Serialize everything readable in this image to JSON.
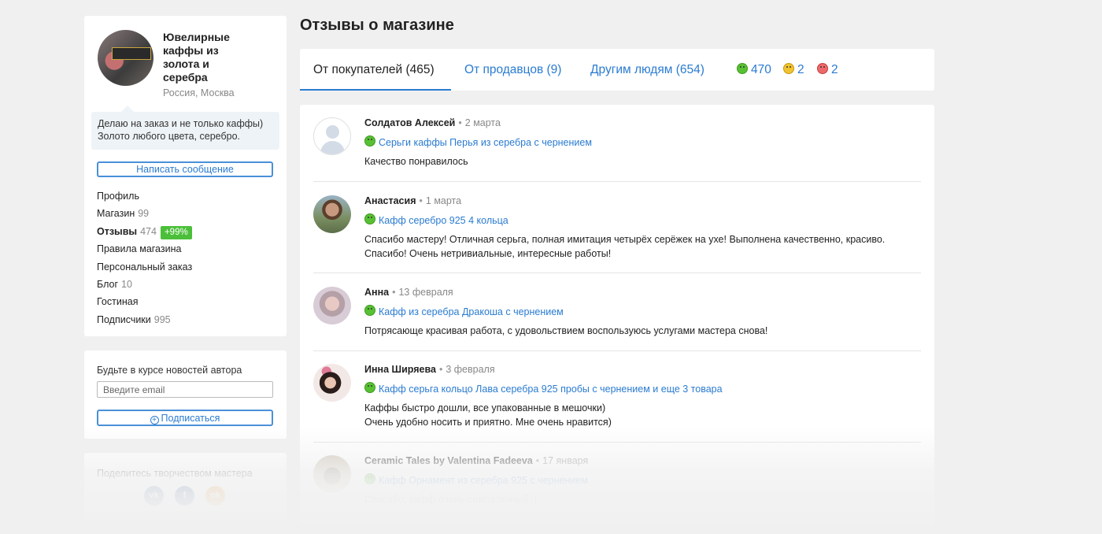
{
  "shop": {
    "name": "Ювелирные каффы из золота и серебра",
    "location": "Россия, Москва",
    "description_line1": "Делаю на заказ и не только каффы)",
    "description_line2": "Золото любого цвета, серебро.",
    "message_button": "Написать сообщение"
  },
  "sidebar_menu": [
    {
      "label": "Профиль",
      "count": ""
    },
    {
      "label": "Магазин",
      "count": "99"
    },
    {
      "label": "Отзывы",
      "count": "474",
      "badge": "+99%",
      "active": true
    },
    {
      "label": "Правила магазина",
      "count": ""
    },
    {
      "label": "Персональный заказ",
      "count": ""
    },
    {
      "label": "Блог",
      "count": "10"
    },
    {
      "label": "Гостиная",
      "count": ""
    },
    {
      "label": "Подписчики",
      "count": "995"
    }
  ],
  "subscribe": {
    "title": "Будьте в курсе новостей автора",
    "placeholder": "Введите email",
    "button": "Подписаться"
  },
  "share": {
    "title": "Поделитесь творчеством мастера",
    "icons": [
      "vk-icon",
      "facebook-icon",
      "odnoklassniki-icon"
    ]
  },
  "page": {
    "title": "Отзывы о магазине"
  },
  "tabs": [
    {
      "label": "От покупателей (465)",
      "active": true
    },
    {
      "label": "От продавцов (9)",
      "active": false
    },
    {
      "label": "Другим людям (654)",
      "active": false
    }
  ],
  "ratings": {
    "positive": "470",
    "neutral": "2",
    "negative": "2"
  },
  "reviews": [
    {
      "author": "Солдатов Алексей",
      "date": "2 марта",
      "product": "Серьги каффы Перья из серебра с чернением",
      "text_lines": [
        "Качество понравилось"
      ]
    },
    {
      "author": "Анастасия",
      "date": "1 марта",
      "product": "Кафф серебро 925 4 кольца",
      "text_lines": [
        "Спасибо мастеру! Отличная серьга, полная имитация четырёх серёжек на ухе! Выполнена качественно, красиво.",
        "Спасибо! Очень нетривиальные, интересные работы!"
      ]
    },
    {
      "author": "Анна",
      "date": "13 февраля",
      "product": "Кафф из серебра Дракоша с чернением",
      "text_lines": [
        "Потрясающе красивая работа, с удовольствием воспользуюсь услугами мастера снова!"
      ]
    },
    {
      "author": "Инна Ширяева",
      "date": "3 февраля",
      "product": "Кафф серьга кольцо Лава серебра 925 пробы с чернением и еще 3 товара",
      "text_lines": [
        "Каффы быстро дошли, все упакованные в мешочки)",
        "Очень удобно носить и приятно. Мне очень нравится)"
      ]
    },
    {
      "author": "Ceramic Tales by Valentina Fadeeva",
      "date": "17 января",
      "product": "Кафф Орнамент из серебра 925 с чернением",
      "text_lines": [
        "Спасибо, кафф очень симпатичный :)"
      ]
    }
  ],
  "colors": {
    "accent": "#2a7bd1",
    "positive": "#58c133",
    "neutral": "#f0c330",
    "negative": "#ee6a6a",
    "badge": "#4cbf3a"
  }
}
